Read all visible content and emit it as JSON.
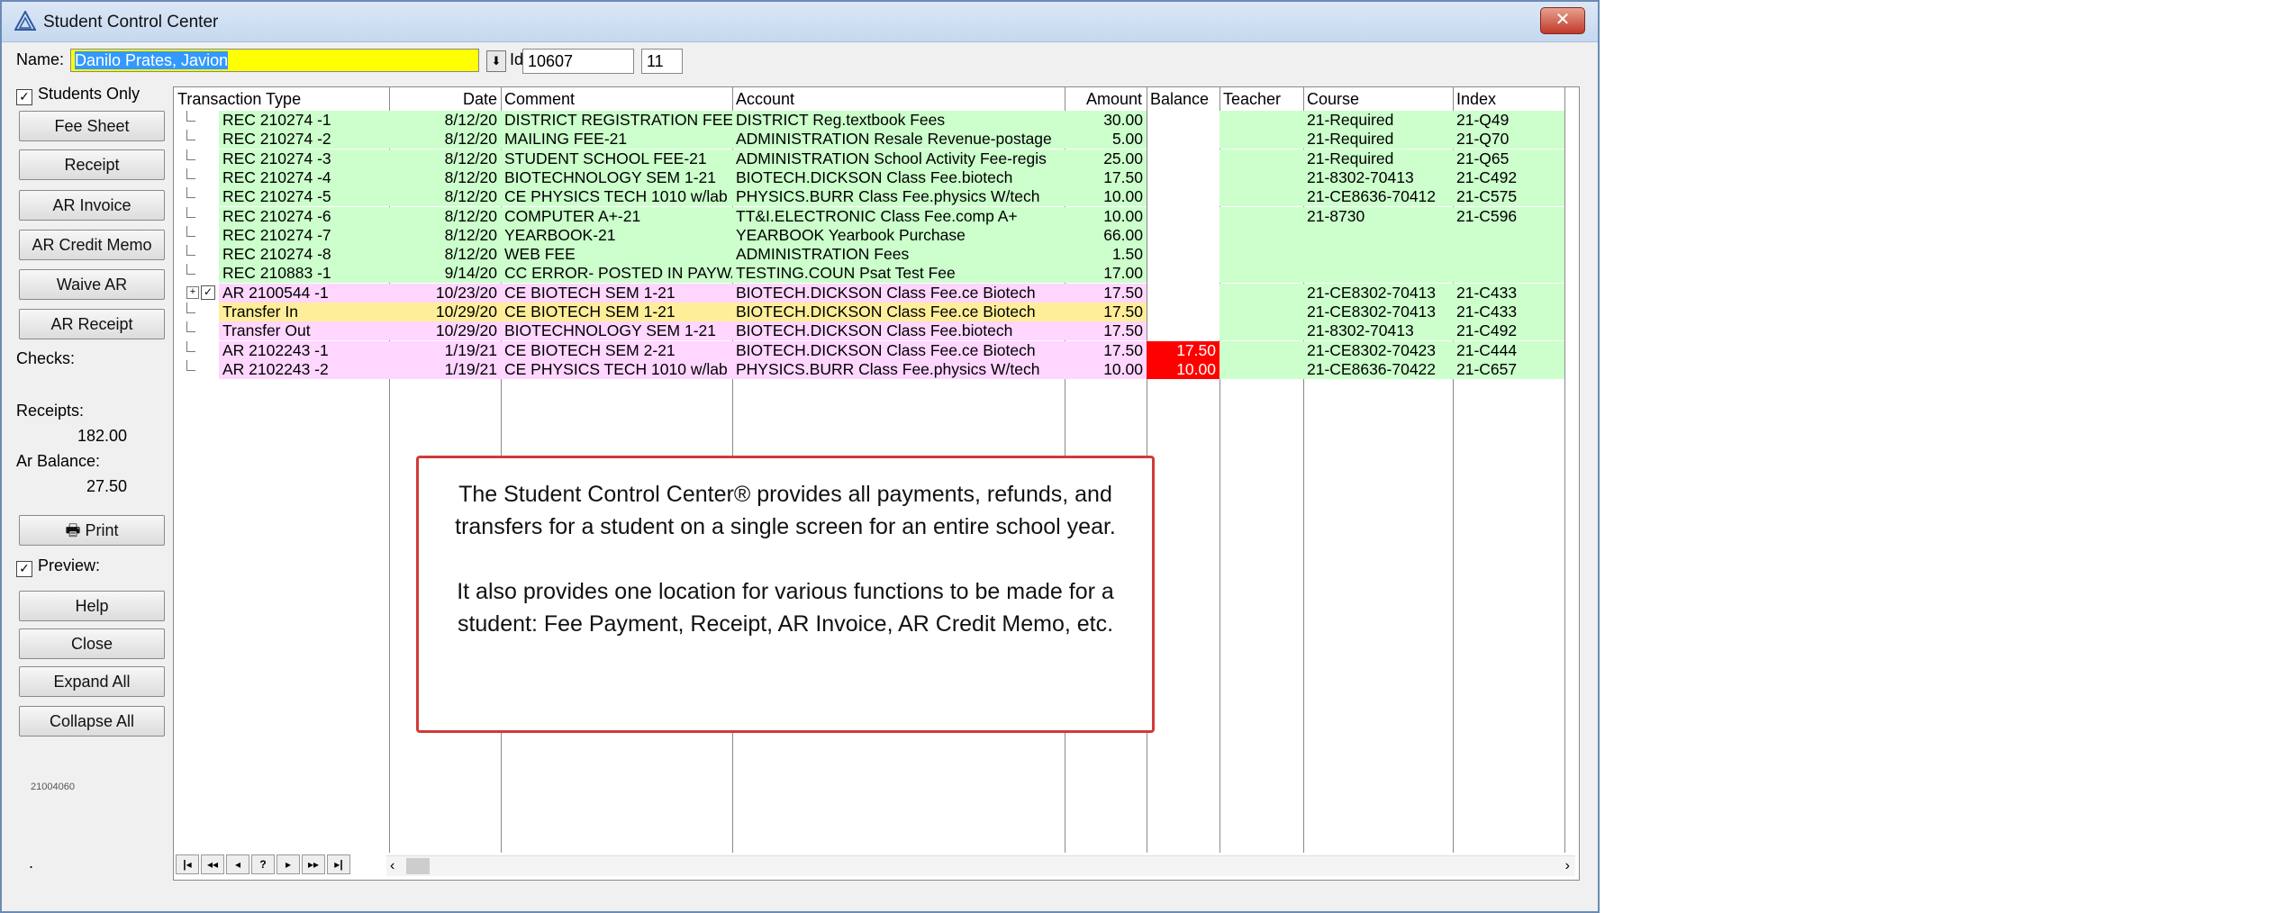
{
  "window": {
    "title": "Student Control Center",
    "close_glyph": "✕"
  },
  "namebar": {
    "name_label": "Name:",
    "name_value": "Danilo Prates, Javion",
    "id_label": "Id:",
    "id_value": "10607",
    "grade_value": "11"
  },
  "sidebar": {
    "students_only_label": "Students Only",
    "students_only_checked": true,
    "buttons": {
      "fee_sheet": "Fee Sheet",
      "receipt": "Receipt",
      "ar_invoice": "AR Invoice",
      "ar_credit_memo": "AR Credit Memo",
      "waive_ar": "Waive AR",
      "ar_receipt": "AR Receipt",
      "print": "Print",
      "help": "Help",
      "close": "Close",
      "expand_all": "Expand All",
      "collapse_all": "Collapse All"
    },
    "checks_label": "Checks:",
    "receipts_label": "Receipts:",
    "receipts_value": "182.00",
    "ar_balance_label": "Ar Balance:",
    "ar_balance_value": "27.50",
    "preview_label": "Preview:",
    "preview_checked": true,
    "footer_code": "21004060",
    "footer_dot": "."
  },
  "grid": {
    "headers": {
      "type": "Transaction Type",
      "date": "Date",
      "comment": "Comment",
      "account": "Account",
      "amount": "Amount",
      "balance": "Balance",
      "teacher": "Teacher",
      "course": "Course",
      "index": "Index"
    },
    "rows": [
      {
        "type": "REC  210274 -1",
        "date": "8/12/20",
        "comment": "DISTRICT REGISTRATION FEE",
        "account": "DISTRICT Reg.textbook Fees",
        "amount": "30.00",
        "balance": "",
        "teacher": "",
        "course": "21-Required",
        "index": "21-Q49",
        "color": "g"
      },
      {
        "type": "REC  210274 -2",
        "date": "8/12/20",
        "comment": "MAILING FEE-21",
        "account": "ADMINISTRATION Resale Revenue-postage",
        "amount": "5.00",
        "balance": "",
        "teacher": "",
        "course": "21-Required",
        "index": "21-Q70",
        "color": "g"
      },
      {
        "type": "REC  210274 -3",
        "date": "8/12/20",
        "comment": "STUDENT SCHOOL FEE-21",
        "account": "ADMINISTRATION School Activity Fee-regis",
        "amount": "25.00",
        "balance": "",
        "teacher": "",
        "course": "21-Required",
        "index": "21-Q65",
        "color": "g"
      },
      {
        "type": "REC  210274 -4",
        "date": "8/12/20",
        "comment": "BIOTECHNOLOGY   SEM 1-21",
        "account": "BIOTECH.DICKSON Class Fee.biotech",
        "amount": "17.50",
        "balance": "",
        "teacher": "",
        "course": "21-8302-70413",
        "index": "21-C492",
        "color": "g"
      },
      {
        "type": "REC  210274 -5",
        "date": "8/12/20",
        "comment": "CE PHYSICS TECH 1010 w/lab",
        "account": "PHYSICS.BURR Class Fee.physics W/tech",
        "amount": "10.00",
        "balance": "",
        "teacher": "",
        "course": "21-CE8636-70412",
        "index": "21-C575",
        "color": "g"
      },
      {
        "type": "REC  210274 -6",
        "date": "8/12/20",
        "comment": "COMPUTER A+-21",
        "account": "TT&I.ELECTRONIC Class Fee.comp A+",
        "amount": "10.00",
        "balance": "",
        "teacher": "",
        "course": "21-8730",
        "index": "21-C596",
        "color": "g"
      },
      {
        "type": "REC  210274 -7",
        "date": "8/12/20",
        "comment": "YEARBOOK-21",
        "account": "YEARBOOK Yearbook Purchase",
        "amount": "66.00",
        "balance": "",
        "teacher": "",
        "course": "",
        "index": "",
        "color": "g"
      },
      {
        "type": "REC  210274 -8",
        "date": "8/12/20",
        "comment": "WEB FEE",
        "account": "ADMINISTRATION Fees",
        "amount": "1.50",
        "balance": "",
        "teacher": "",
        "course": "",
        "index": "",
        "color": "g"
      },
      {
        "type": "REC  210883 -1",
        "date": "9/14/20",
        "comment": "CC ERROR- POSTED IN PAYWA",
        "account": "TESTING.COUN Psat Test Fee",
        "amount": "17.00",
        "balance": "",
        "teacher": "",
        "course": "",
        "index": "",
        "color": "g"
      },
      {
        "type": "AR   2100544 -1",
        "date": "10/23/20",
        "comment": "CE BIOTECH  SEM 1-21",
        "account": "BIOTECH.DICKSON Class Fee.ce Biotech",
        "amount": "17.50",
        "balance": "",
        "teacher": "",
        "course": "21-CE8302-70413",
        "index": "21-C433",
        "color": "p",
        "expand": true
      },
      {
        "type": "Transfer In",
        "date": "10/29/20",
        "comment": "CE BIOTECH  SEM 1-21",
        "account": "BIOTECH.DICKSON Class Fee.ce Biotech",
        "amount": "17.50",
        "balance": "",
        "teacher": "",
        "course": "21-CE8302-70413",
        "index": "21-C433",
        "color": "y"
      },
      {
        "type": "Transfer Out",
        "date": "10/29/20",
        "comment": "BIOTECHNOLOGY   SEM 1-21",
        "account": "BIOTECH.DICKSON Class Fee.biotech",
        "amount": "17.50",
        "balance": "",
        "teacher": "",
        "course": "21-8302-70413",
        "index": "21-C492",
        "color": "p"
      },
      {
        "type": "AR   2102243 -1",
        "date": "1/19/21",
        "comment": "CE BIOTECH  SEM 2-21",
        "account": "BIOTECH.DICKSON Class Fee.ce Biotech",
        "amount": "17.50",
        "balance": "17.50",
        "teacher": "",
        "course": "21-CE8302-70423",
        "index": "21-C444",
        "color": "p"
      },
      {
        "type": "AR   2102243 -2",
        "date": "1/19/21",
        "comment": "CE PHYSICS TECH 1010 w/lab",
        "account": "PHYSICS.BURR Class Fee.physics W/tech",
        "amount": "10.00",
        "balance": "10.00",
        "teacher": "",
        "course": "21-CE8636-70422",
        "index": "21-C657",
        "color": "p"
      }
    ],
    "nav": [
      "|◂",
      "◂◂",
      "◂",
      "?",
      "▸",
      "▸▸",
      "▸|"
    ]
  },
  "callout": {
    "para1": "The Student Control Center® provides all payments, refunds, and transfers for a student on a single screen for an entire school year.",
    "para2": "It also provides one location for various functions to be made for a student: Fee Payment, Receipt, AR Invoice, AR Credit Memo, etc."
  },
  "colors": {
    "green_row": "#ccffcc",
    "pink_row": "#ffd6ff",
    "yellow_row": "#ffee99",
    "balance_due": "#ff0000",
    "name_highlight": "#ffff00",
    "callout_border": "#d03a3a"
  }
}
